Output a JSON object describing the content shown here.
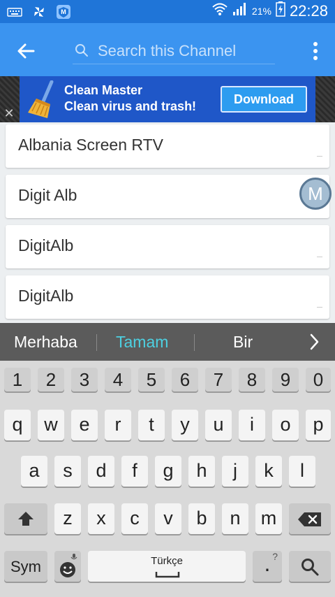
{
  "status_bar": {
    "battery_percent": "21%",
    "time": "22:28",
    "icons": [
      "keyboard-icon",
      "pinwheel-icon",
      "app-icon",
      "wifi-icon",
      "signal-icon",
      "battery-charging-icon"
    ]
  },
  "app_bar": {
    "search_placeholder": "Search this Channel",
    "icons": [
      "back-arrow-icon",
      "search-icon",
      "overflow-menu-icon"
    ]
  },
  "ad": {
    "title": "Clean Master",
    "subtitle": "Clean virus and trash!",
    "cta": "Download",
    "close": "✕"
  },
  "channels": [
    {
      "label": "Albania Screen RTV"
    },
    {
      "label": "Digit Alb"
    },
    {
      "label": "DigitAlb"
    },
    {
      "label": "DigitAlb"
    }
  ],
  "floating_button": {
    "label": "M"
  },
  "suggestions": {
    "items": [
      "Merhaba",
      "Tamam",
      "Bir"
    ],
    "highlight_color": "#4dd0e1"
  },
  "keyboard": {
    "numbers": [
      "1",
      "2",
      "3",
      "4",
      "5",
      "6",
      "7",
      "8",
      "9",
      "0"
    ],
    "row1": [
      "q",
      "w",
      "e",
      "r",
      "t",
      "y",
      "u",
      "i",
      "o",
      "p"
    ],
    "row2": [
      "a",
      "s",
      "d",
      "f",
      "g",
      "h",
      "j",
      "k",
      "l"
    ],
    "row3": [
      "z",
      "x",
      "c",
      "v",
      "b",
      "n",
      "m"
    ],
    "sym_label": "Sym",
    "space_label": "Türkçe",
    "period_label": ".",
    "period_hint": "?"
  },
  "colors": {
    "status_bar": "#1f75d8",
    "app_bar": "#3b94f0",
    "ad_background": "#1f57c8"
  }
}
